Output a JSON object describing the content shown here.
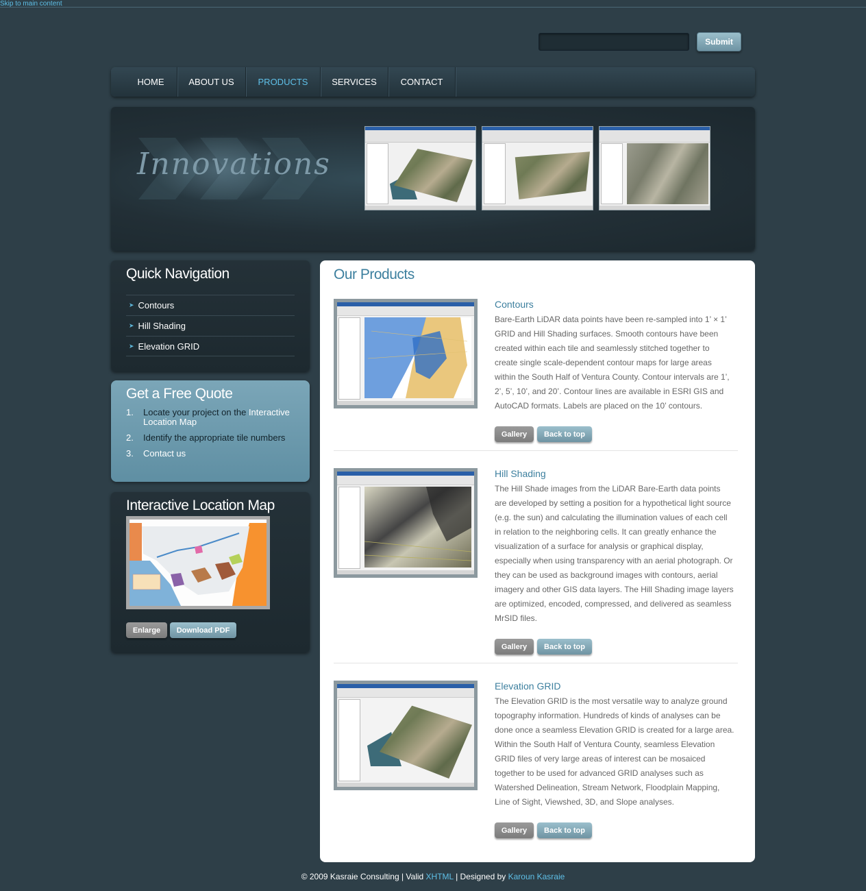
{
  "skip_link": "Skip to main content",
  "search": {
    "placeholder": "",
    "submit_label": "Submit"
  },
  "nav": {
    "items": [
      {
        "label": "HOME",
        "active": false
      },
      {
        "label": "ABOUT US",
        "active": false
      },
      {
        "label": "PRODUCTS",
        "active": true
      },
      {
        "label": "SERVICES",
        "active": false
      },
      {
        "label": "CONTACT",
        "active": false
      }
    ]
  },
  "banner": {
    "title": "Innovations"
  },
  "quick_nav": {
    "title": "Quick Navigation",
    "items": [
      "Contours",
      "Hill Shading",
      "Elevation GRID"
    ]
  },
  "quote": {
    "title": "Get a Free Quote",
    "steps": [
      {
        "num": "1.",
        "text": "Locate your project on the ",
        "link": "Interactive Location Map"
      },
      {
        "num": "2.",
        "text": "Identify the appropriate tile numbers",
        "link": ""
      },
      {
        "num": "3.",
        "text": "",
        "link": "Contact us"
      }
    ]
  },
  "location_map": {
    "title": "Interactive Location Map",
    "enlarge_label": "Enlarge",
    "download_label": "Download PDF"
  },
  "products": {
    "title": "Our Products",
    "items": [
      {
        "name": "Contours",
        "description": "Bare-Earth LiDAR data points have been re-sampled into 1’ × 1’ GRID and Hill Shading surfaces. Smooth contours have been created within each tile and seamlessly stitched together to create single scale-dependent contour maps for large areas within the South Half of Ventura County. Contour intervals are 1’, 2’, 5’, 10’, and 20’. Contour lines are available in ESRI GIS and AutoCAD formats. Labels are placed on the 10’ contours.",
        "gallery_label": "Gallery",
        "top_label": "Back to top"
      },
      {
        "name": "Hill Shading",
        "description": "The Hill Shade images from the LiDAR Bare-Earth data points are developed by setting a position for a hypothetical light source (e.g. the sun) and calculating the illumination values of each cell in relation to the neighboring cells. It can greatly enhance the visualization of a surface for analysis or graphical display, especially when using transparency with an aerial photograph. Or they can be used as background images with contours, aerial imagery and other GIS data layers. The Hill Shading image layers are optimized, encoded, compressed, and delivered as seamless MrSID files.",
        "gallery_label": "Gallery",
        "top_label": "Back to top"
      },
      {
        "name": "Elevation GRID",
        "description": "The Elevation GRID is the most versatile way to analyze ground topography information. Hundreds of kinds of analyses can be done once a seamless Elevation GRID is created for a large area. Within the South Half of Ventura County, seamless Elevation GRID files of very large areas of interest can be mosaiced together to be used for advanced GRID analyses such as Watershed Delineation, Stream Network, Floodplain Mapping, Line of Sight, Viewshed, 3D, and Slope analyses.",
        "gallery_label": "Gallery",
        "top_label": "Back to top"
      }
    ]
  },
  "footer": {
    "copyright": "© 2009 Kasraie Consulting | Valid ",
    "xhtml": "XHTML",
    "designed": " | Designed by ",
    "designer": "Karoun Kasraie"
  },
  "colors": {
    "background": "#2e3f48",
    "accent": "#5fc0e8",
    "heading_blue": "#3c7f9e",
    "quote_panel": "#6b99ac"
  }
}
